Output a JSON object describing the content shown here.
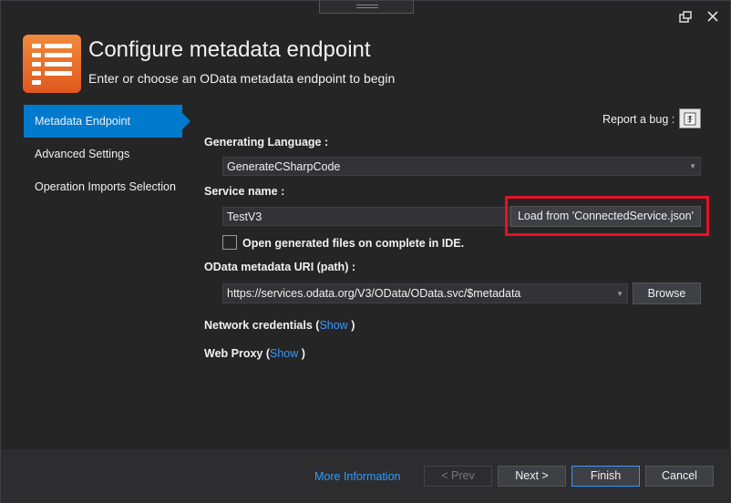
{
  "header": {
    "title": "Configure metadata endpoint",
    "subtitle": "Enter or choose an OData metadata endpoint to begin"
  },
  "nav": {
    "items": [
      {
        "label": "Metadata Endpoint",
        "active": true
      },
      {
        "label": "Advanced Settings",
        "active": false
      },
      {
        "label": "Operation Imports Selection",
        "active": false
      }
    ]
  },
  "report_bug": {
    "label": "Report a bug :"
  },
  "generating_language": {
    "label": "Generating Language :",
    "value": "GenerateCSharpCode"
  },
  "service_name": {
    "label": "Service name :",
    "value": "TestV3",
    "load_button": "Load from 'ConnectedService.json'"
  },
  "open_files": {
    "label": "Open generated files on complete in IDE.",
    "checked": false
  },
  "metadata_uri": {
    "label": "OData metadata URI (path) :",
    "value": "https://services.odata.org/V3/OData/OData.svc/$metadata",
    "browse_button": "Browse"
  },
  "network_credentials": {
    "label": "Network credentials (",
    "link": "Show",
    "close": " )"
  },
  "web_proxy": {
    "label": "Web Proxy (",
    "link": "Show",
    "close": " )"
  },
  "footer": {
    "more_info": "More Information",
    "prev": "< Prev",
    "next": "Next >",
    "finish": "Finish",
    "cancel": "Cancel"
  },
  "colors": {
    "background": "#252526",
    "accent": "#007acc",
    "link": "#3399ff",
    "highlight": "#e81123",
    "icon": "#e0581e"
  }
}
